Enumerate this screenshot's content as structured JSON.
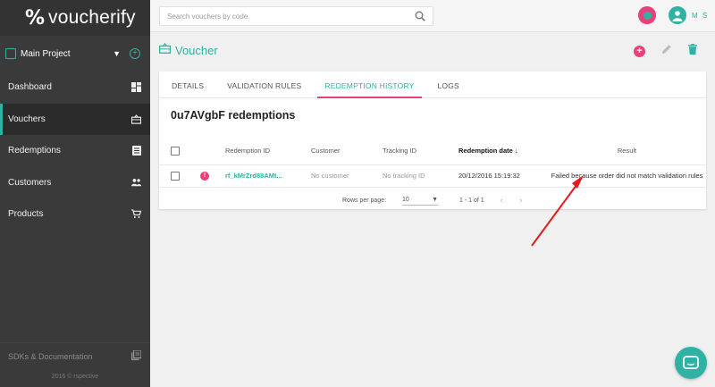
{
  "app": {
    "logo_text": "voucherify",
    "logo_mark": "%"
  },
  "project": {
    "name": "Main Project"
  },
  "nav": [
    {
      "label": "Dashboard",
      "icon": "dashboard-icon"
    },
    {
      "label": "Vouchers",
      "icon": "voucher-icon",
      "active": true
    },
    {
      "label": "Redemptions",
      "icon": "list-icon"
    },
    {
      "label": "Customers",
      "icon": "people-icon"
    },
    {
      "label": "Products",
      "icon": "cart-icon"
    }
  ],
  "footer": {
    "sdk_label": "SDKs & Documentation",
    "copyright": "2016 © rspective"
  },
  "search": {
    "placeholder": "Search vouchers by code"
  },
  "user": {
    "initials": "M S"
  },
  "page": {
    "title": "Voucher"
  },
  "tabs": [
    {
      "label": "DETAILS"
    },
    {
      "label": "VALIDATION RULES"
    },
    {
      "label": "REDEMPTION HISTORY",
      "active": true
    },
    {
      "label": "LOGS"
    }
  ],
  "section_title": "0u7AVgbF redemptions",
  "table": {
    "headers": {
      "redemption_id": "Redemption ID",
      "customer": "Customer",
      "tracking_id": "Tracking ID",
      "redemption_date": "Redemption date",
      "result": "Result"
    },
    "rows": [
      {
        "status": "!",
        "redemption_id": "rf_kMrZrd88AMt...",
        "customer": "No customer",
        "tracking_id": "No tracking ID",
        "redemption_date": "20/12/2016 15:19:32",
        "result": "Failed because order did not match validation rules"
      }
    ]
  },
  "pagination": {
    "rows_label": "Rows per page:",
    "rows_value": "10",
    "range": "1 - 1 of 1"
  },
  "colors": {
    "accent": "#2fb1a4",
    "pink": "#e9407a",
    "sidebar": "#3a3a3a",
    "annotation": "#e21b1b"
  }
}
